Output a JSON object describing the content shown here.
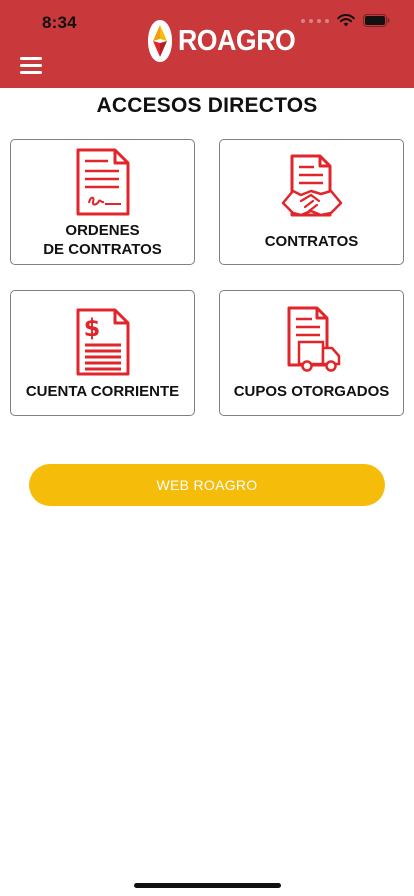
{
  "status_bar": {
    "time": "8:34"
  },
  "header": {
    "brand": "ROAGRO",
    "menu_icon": "hamburger-menu-icon"
  },
  "page": {
    "title": "ACCESOS DIRECTOS"
  },
  "tiles": [
    {
      "line1": "ORDENES",
      "line2": "DE CONTRATOS",
      "icon": "signed-document-icon"
    },
    {
      "label": "CONTRATOS",
      "icon": "handshake-contract-icon"
    },
    {
      "label": "CUENTA CORRIENTE",
      "icon": "dollar-statement-icon"
    },
    {
      "label": "CUPOS OTORGADOS",
      "icon": "document-truck-icon"
    }
  ],
  "web_button": {
    "label": "WEB ROAGRO"
  },
  "colors": {
    "header": "#c9383a",
    "accent_icon": "#e0262b",
    "button": "#f5bd0a"
  }
}
